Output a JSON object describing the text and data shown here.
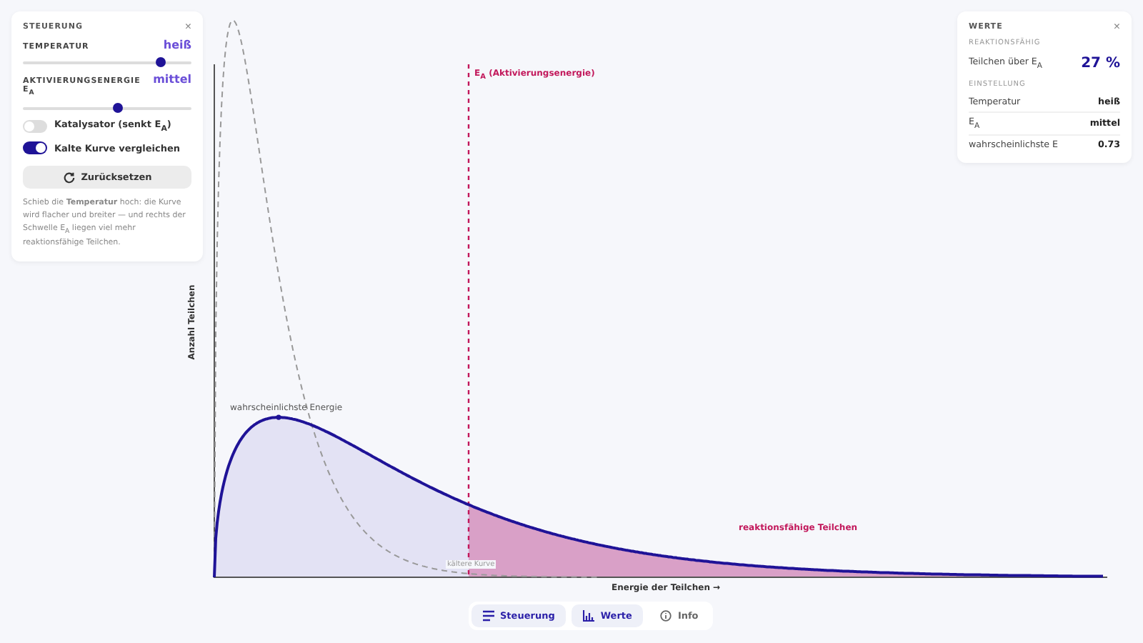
{
  "controls": {
    "title": "STEUERUNG",
    "close": "×",
    "sliders": [
      {
        "label": "TEMPERATUR",
        "value": "heiß",
        "level": 0.82
      },
      {
        "label": "AKTIVIERUNGSENERGIE E$_{A}$",
        "value": "mittel",
        "level": 0.56
      }
    ],
    "toggles": [
      {
        "label": "Katalysator (senkt E$_{A}$)",
        "on": false
      },
      {
        "label": "Kalte Kurve vergleichen",
        "on": true
      }
    ],
    "reset": "Zurücksetzen",
    "hint": "Schieb die **Temperatur** hoch: die Kurve wird flacher und breiter — und rechts der Schwelle E$_{A}$ liegen viel mehr reaktionsfähige Teilchen."
  },
  "values": {
    "title": "WERTE",
    "close": "×",
    "section_1": "REAKTIONSFÄHIG",
    "highlight": {
      "label": "Teilchen über E$_{A}$",
      "value": "27 %"
    },
    "section_2": "EINSTELLUNG",
    "rows": [
      {
        "label": "Temperatur",
        "value": "heiß"
      },
      {
        "label": "E$_{A}$",
        "value": "mittel"
      },
      {
        "label": "wahrscheinlichste E",
        "value": "0.73"
      }
    ]
  },
  "chart": {
    "ylabel": "Anzahl Teilchen",
    "xlabel": "Energie der Teilchen →",
    "threshold_label": "E$_{A}$ (Aktivierungsenergie)",
    "peak_label": "wahrscheinlichste Energie",
    "region_label": "reaktionsfähige Teilchen",
    "cold_label": "kältere Kurve"
  },
  "tabs": [
    {
      "label": "Steuerung",
      "kind": "lines",
      "selected": true
    },
    {
      "label": "Werte",
      "kind": "bars",
      "selected": true
    },
    {
      "label": "Info",
      "kind": "info",
      "selected": false
    }
  ]
}
